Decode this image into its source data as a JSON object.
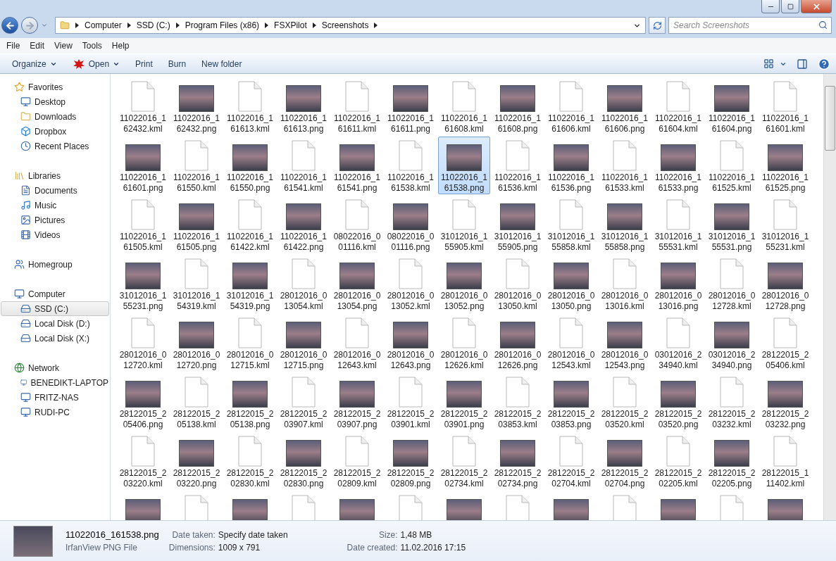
{
  "address": {
    "crumbs": [
      "Computer",
      "SSD (C:)",
      "Program Files (x86)",
      "FSXPilot",
      "Screenshots"
    ],
    "search_placeholder": "Search Screenshots"
  },
  "menu": [
    "File",
    "Edit",
    "View",
    "Tools",
    "Help"
  ],
  "toolbar": [
    {
      "label": "Organize",
      "dropdown": true,
      "kind": "plain"
    },
    {
      "label": "Open",
      "dropdown": true,
      "kind": "app"
    },
    {
      "label": "Print",
      "dropdown": false,
      "kind": "plain"
    },
    {
      "label": "Burn",
      "dropdown": false,
      "kind": "plain"
    },
    {
      "label": "New folder",
      "dropdown": false,
      "kind": "plain"
    }
  ],
  "sidebar": [
    {
      "label": "Favorites",
      "kind": "favorites",
      "selected": false,
      "children": [
        {
          "label": "Desktop",
          "kind": "desktop",
          "selected": false
        },
        {
          "label": "Downloads",
          "kind": "folder",
          "selected": false
        },
        {
          "label": "Dropbox",
          "kind": "dropbox",
          "selected": false
        },
        {
          "label": "Recent Places",
          "kind": "recent",
          "selected": false
        }
      ]
    },
    {
      "label": "Libraries",
      "kind": "library",
      "selected": false,
      "children": [
        {
          "label": "Documents",
          "kind": "documents",
          "selected": false
        },
        {
          "label": "Music",
          "kind": "music",
          "selected": false
        },
        {
          "label": "Pictures",
          "kind": "pictures",
          "selected": false
        },
        {
          "label": "Videos",
          "kind": "videos",
          "selected": false
        }
      ]
    },
    {
      "label": "Homegroup",
      "kind": "homegroup",
      "selected": false
    },
    {
      "label": "Computer",
      "kind": "computer",
      "selected": false,
      "children": [
        {
          "label": "SSD (C:)",
          "kind": "system-drive",
          "selected": true
        },
        {
          "label": "Local Disk (D:)",
          "kind": "drive",
          "selected": false
        },
        {
          "label": "Local Disk (X:)",
          "kind": "drive",
          "selected": false
        }
      ]
    },
    {
      "label": "Network",
      "kind": "network",
      "selected": false,
      "children": [
        {
          "label": "BENEDIKT-LAPTOP",
          "kind": "computer",
          "selected": false
        },
        {
          "label": "FRITZ-NAS",
          "kind": "computer",
          "selected": false
        },
        {
          "label": "RUDI-PC",
          "kind": "computer",
          "selected": false
        }
      ]
    }
  ],
  "files": [
    {
      "name": "11022016_162432.kml",
      "kind": "kml",
      "selected": false
    },
    {
      "name": "11022016_162432.png",
      "kind": "png",
      "selected": false
    },
    {
      "name": "11022016_161613.kml",
      "kind": "kml",
      "selected": false
    },
    {
      "name": "11022016_161613.png",
      "kind": "png",
      "selected": false
    },
    {
      "name": "11022016_161611.kml",
      "kind": "kml",
      "selected": false
    },
    {
      "name": "11022016_161611.png",
      "kind": "png",
      "selected": false
    },
    {
      "name": "11022016_161608.kml",
      "kind": "kml",
      "selected": false
    },
    {
      "name": "11022016_161608.png",
      "kind": "png",
      "selected": false
    },
    {
      "name": "11022016_161606.kml",
      "kind": "kml",
      "selected": false
    },
    {
      "name": "11022016_161606.png",
      "kind": "png",
      "selected": false
    },
    {
      "name": "11022016_161604.kml",
      "kind": "kml",
      "selected": false
    },
    {
      "name": "11022016_161604.png",
      "kind": "png",
      "selected": false
    },
    {
      "name": "11022016_161601.kml",
      "kind": "kml",
      "selected": false
    },
    {
      "name": "11022016_161601.png",
      "kind": "png",
      "selected": false
    },
    {
      "name": "11022016_161550.kml",
      "kind": "kml",
      "selected": false
    },
    {
      "name": "11022016_161550.png",
      "kind": "png",
      "selected": false
    },
    {
      "name": "11022016_161541.kml",
      "kind": "kml",
      "selected": false
    },
    {
      "name": "11022016_161541.png",
      "kind": "png",
      "selected": false
    },
    {
      "name": "11022016_161538.kml",
      "kind": "kml",
      "selected": false
    },
    {
      "name": "11022016_161538.png",
      "kind": "png",
      "selected": true
    },
    {
      "name": "11022016_161536.kml",
      "kind": "kml",
      "selected": false
    },
    {
      "name": "11022016_161536.png",
      "kind": "png",
      "selected": false
    },
    {
      "name": "11022016_161533.kml",
      "kind": "kml",
      "selected": false
    },
    {
      "name": "11022016_161533.png",
      "kind": "png",
      "selected": false
    },
    {
      "name": "11022016_161525.kml",
      "kind": "kml",
      "selected": false
    },
    {
      "name": "11022016_161525.png",
      "kind": "png",
      "selected": false
    },
    {
      "name": "11022016_161505.kml",
      "kind": "kml",
      "selected": false
    },
    {
      "name": "11022016_161505.png",
      "kind": "png",
      "selected": false
    },
    {
      "name": "11022016_161422.kml",
      "kind": "kml",
      "selected": false
    },
    {
      "name": "11022016_161422.png",
      "kind": "png",
      "selected": false
    },
    {
      "name": "08022016_001116.kml",
      "kind": "kml",
      "selected": false
    },
    {
      "name": "08022016_001116.png",
      "kind": "png",
      "selected": false
    },
    {
      "name": "31012016_155905.kml",
      "kind": "kml",
      "selected": false
    },
    {
      "name": "31012016_155905.png",
      "kind": "png",
      "selected": false
    },
    {
      "name": "31012016_155858.kml",
      "kind": "kml",
      "selected": false
    },
    {
      "name": "31012016_155858.png",
      "kind": "png",
      "selected": false
    },
    {
      "name": "31012016_155531.kml",
      "kind": "kml",
      "selected": false
    },
    {
      "name": "31012016_155531.png",
      "kind": "png",
      "selected": false
    },
    {
      "name": "31012016_155231.kml",
      "kind": "kml",
      "selected": false
    },
    {
      "name": "31012016_155231.png",
      "kind": "png",
      "selected": false
    },
    {
      "name": "31012016_154319.kml",
      "kind": "kml",
      "selected": false
    },
    {
      "name": "31012016_154319.png",
      "kind": "png",
      "selected": false
    },
    {
      "name": "28012016_013054.kml",
      "kind": "kml",
      "selected": false
    },
    {
      "name": "28012016_013054.png",
      "kind": "png",
      "selected": false
    },
    {
      "name": "28012016_013052.kml",
      "kind": "kml",
      "selected": false
    },
    {
      "name": "28012016_013052.png",
      "kind": "png",
      "selected": false
    },
    {
      "name": "28012016_013050.kml",
      "kind": "kml",
      "selected": false
    },
    {
      "name": "28012016_013050.png",
      "kind": "png",
      "selected": false
    },
    {
      "name": "28012016_013016.kml",
      "kind": "kml",
      "selected": false
    },
    {
      "name": "28012016_013016.png",
      "kind": "png",
      "selected": false
    },
    {
      "name": "28012016_012728.kml",
      "kind": "kml",
      "selected": false
    },
    {
      "name": "28012016_012728.png",
      "kind": "png",
      "selected": false
    },
    {
      "name": "28012016_012720.kml",
      "kind": "kml",
      "selected": false
    },
    {
      "name": "28012016_012720.png",
      "kind": "png",
      "selected": false
    },
    {
      "name": "28012016_012715.kml",
      "kind": "kml",
      "selected": false
    },
    {
      "name": "28012016_012715.png",
      "kind": "png",
      "selected": false
    },
    {
      "name": "28012016_012643.kml",
      "kind": "kml",
      "selected": false
    },
    {
      "name": "28012016_012643.png",
      "kind": "png",
      "selected": false
    },
    {
      "name": "28012016_012626.kml",
      "kind": "kml",
      "selected": false
    },
    {
      "name": "28012016_012626.png",
      "kind": "png",
      "selected": false
    },
    {
      "name": "28012016_012543.kml",
      "kind": "kml",
      "selected": false
    },
    {
      "name": "28012016_012543.png",
      "kind": "png",
      "selected": false
    },
    {
      "name": "03012016_234940.kml",
      "kind": "kml",
      "selected": false
    },
    {
      "name": "03012016_234940.png",
      "kind": "png",
      "selected": false
    },
    {
      "name": "28122015_205406.kml",
      "kind": "kml",
      "selected": false
    },
    {
      "name": "28122015_205406.png",
      "kind": "png",
      "selected": false
    },
    {
      "name": "28122015_205138.kml",
      "kind": "kml",
      "selected": false
    },
    {
      "name": "28122015_205138.png",
      "kind": "png",
      "selected": false
    },
    {
      "name": "28122015_203907.kml",
      "kind": "kml",
      "selected": false
    },
    {
      "name": "28122015_203907.png",
      "kind": "png",
      "selected": false
    },
    {
      "name": "28122015_203901.kml",
      "kind": "kml",
      "selected": false
    },
    {
      "name": "28122015_203901.png",
      "kind": "png",
      "selected": false
    },
    {
      "name": "28122015_203853.kml",
      "kind": "kml",
      "selected": false
    },
    {
      "name": "28122015_203853.png",
      "kind": "png",
      "selected": false
    },
    {
      "name": "28122015_203520.kml",
      "kind": "kml",
      "selected": false
    },
    {
      "name": "28122015_203520.png",
      "kind": "png",
      "selected": false
    },
    {
      "name": "28122015_203232.kml",
      "kind": "kml",
      "selected": false
    },
    {
      "name": "28122015_203232.png",
      "kind": "png",
      "selected": false
    },
    {
      "name": "28122015_203220.kml",
      "kind": "kml",
      "selected": false
    },
    {
      "name": "28122015_203220.png",
      "kind": "png",
      "selected": false
    },
    {
      "name": "28122015_202830.kml",
      "kind": "kml",
      "selected": false
    },
    {
      "name": "28122015_202830.png",
      "kind": "png",
      "selected": false
    },
    {
      "name": "28122015_202809.kml",
      "kind": "kml",
      "selected": false
    },
    {
      "name": "28122015_202809.png",
      "kind": "png",
      "selected": false
    },
    {
      "name": "28122015_202734.kml",
      "kind": "kml",
      "selected": false
    },
    {
      "name": "28122015_202734.png",
      "kind": "png",
      "selected": false
    },
    {
      "name": "28122015_202704.kml",
      "kind": "kml",
      "selected": false
    },
    {
      "name": "28122015_202704.png",
      "kind": "png",
      "selected": false
    },
    {
      "name": "28122015_202205.kml",
      "kind": "kml",
      "selected": false
    },
    {
      "name": "28122015_202205.png",
      "kind": "png",
      "selected": false
    },
    {
      "name": "28122015_111402.kml",
      "kind": "kml",
      "selected": false
    }
  ],
  "partial_row": [
    {
      "kind": "png"
    },
    {
      "kind": "kml"
    },
    {
      "kind": "png"
    },
    {
      "kind": "kml"
    },
    {
      "kind": "png"
    },
    {
      "kind": "kml"
    },
    {
      "kind": "png"
    },
    {
      "kind": "kml"
    },
    {
      "kind": "png"
    },
    {
      "kind": "kml"
    },
    {
      "kind": "png"
    },
    {
      "kind": "kml"
    },
    {
      "kind": "png"
    }
  ],
  "details": {
    "name": "11022016_161538.png",
    "type": "IrfanView PNG File",
    "fields": [
      {
        "label": "Date taken:",
        "value": "Specify date taken"
      },
      {
        "label": "Size:",
        "value": "1,48 MB"
      },
      {
        "label": "Dimensions:",
        "value": "1009 x 791"
      },
      {
        "label": "Date created:",
        "value": "11.02.2016 17:15"
      }
    ]
  }
}
